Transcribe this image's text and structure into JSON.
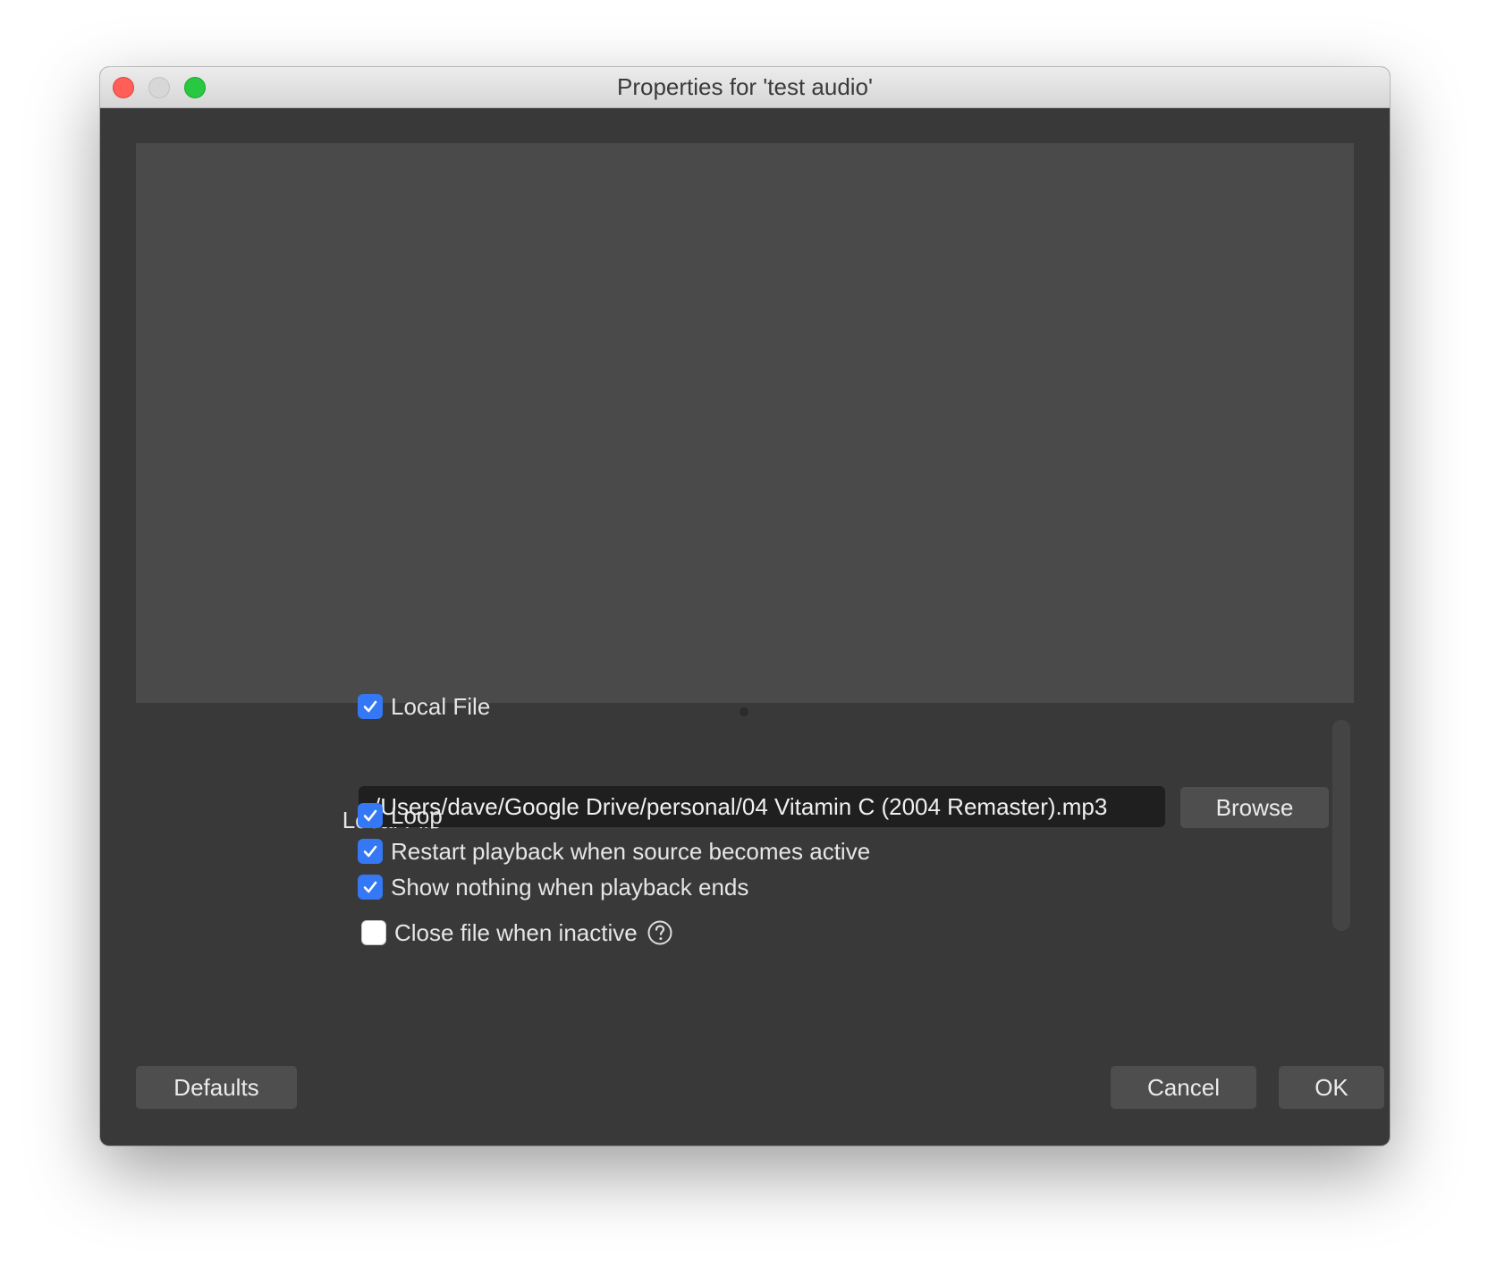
{
  "window": {
    "title": "Properties for 'test audio'"
  },
  "properties": {
    "local_file_checkbox": {
      "label": "Local File",
      "checked": true
    },
    "local_file_field": {
      "label": "Local File",
      "value": "/Users/dave/Google Drive/personal/04 Vitamin C (2004 Remaster).mp3",
      "browse_label": "Browse"
    },
    "loop": {
      "label": "Loop",
      "checked": true
    },
    "restart_playback": {
      "label": "Restart playback when source becomes active",
      "checked": true
    },
    "show_nothing": {
      "label": "Show nothing when playback ends",
      "checked": true
    },
    "close_file": {
      "label": "Close file when inactive",
      "checked": false,
      "help_icon": "question-circle-icon"
    }
  },
  "footer": {
    "defaults_label": "Defaults",
    "cancel_label": "Cancel",
    "ok_label": "OK"
  },
  "colors": {
    "window_bg": "#393939",
    "preview_bg": "#4a4a4a",
    "checkbox_accent": "#3478f6",
    "button_bg": "#4e4e4e",
    "input_bg": "#1f1f1f"
  }
}
